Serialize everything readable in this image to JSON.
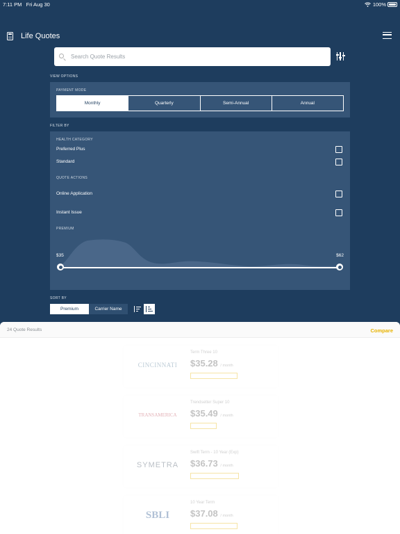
{
  "status_bar": {
    "time": "7:11 PM",
    "date": "Fri Aug 30",
    "battery": "100%"
  },
  "app": {
    "title": "Life Quotes"
  },
  "search": {
    "placeholder": "Search Quote Results"
  },
  "view_options": {
    "label": "VIEW OPTIONS",
    "payment_mode_label": "PAYMENT MODE",
    "payment_modes": [
      "Monthly",
      "Quarterly",
      "Semi-Annual",
      "Annual"
    ],
    "selected_mode": "Monthly"
  },
  "filter_by": {
    "label": "FILTER BY",
    "health_category_label": "HEALTH CATEGORY",
    "health_categories": [
      {
        "label": "Preferred Plus",
        "checked": false
      },
      {
        "label": "Standard",
        "checked": false
      }
    ],
    "quote_actions_label": "QUOTE ACTIONS",
    "quote_actions": [
      {
        "label": "Online Application",
        "checked": false
      },
      {
        "label": "Instant Issue",
        "checked": false
      }
    ],
    "premium_label": "PREMIUM",
    "premium_min": "$35",
    "premium_max": "$62"
  },
  "sort_by": {
    "label": "SORT BY",
    "options": [
      "Premium",
      "Carrier Name"
    ],
    "selected": "Premium",
    "order_selected": "ascending"
  },
  "results": {
    "count_label": "24 Quote Results",
    "compare_label": "Compare",
    "quotes": [
      {
        "logo": "CINCINNATI",
        "plan": "Term Three 10",
        "price": "$35.28",
        "per": "/ month"
      },
      {
        "logo": "TRANSAMERICA",
        "plan": "Trendsetter Super 10",
        "price": "$35.49",
        "per": "/ month"
      },
      {
        "logo": "SYMETRA",
        "plan": "Swift Term - 10 Year (Exp)",
        "price": "$36.73",
        "per": "/ month"
      },
      {
        "logo": "SBLI",
        "plan": "10 Year Term",
        "price": "$37.08",
        "per": "/ month"
      }
    ]
  },
  "colors": {
    "background": "#1e3d5e",
    "panel": "#365577",
    "accent": "#e8b300"
  }
}
